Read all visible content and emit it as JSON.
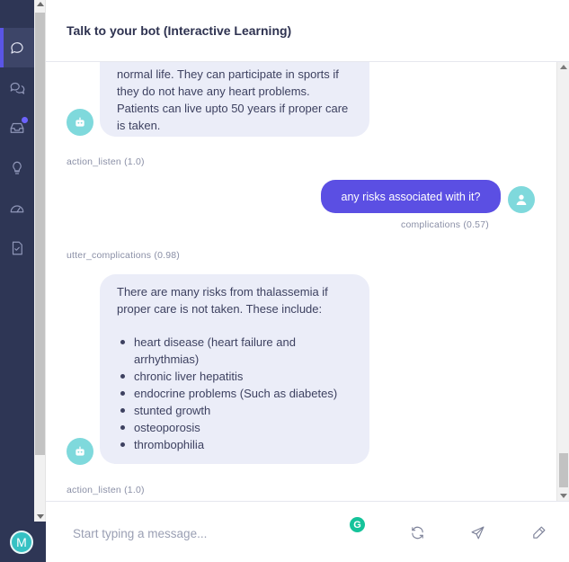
{
  "header": {
    "title": "Talk to your bot (Interactive Learning)"
  },
  "rail": {
    "items": [
      {
        "icon": "chat-bubble-icon",
        "active": true
      },
      {
        "icon": "conversations-icon",
        "active": false
      },
      {
        "icon": "inbox-icon",
        "active": false,
        "notification": true
      },
      {
        "icon": "lightbulb-icon",
        "active": false
      },
      {
        "icon": "gauge-icon",
        "active": false
      },
      {
        "icon": "document-check-icon",
        "active": false
      }
    ],
    "user_initial": "M"
  },
  "chat": {
    "messages": [
      {
        "role": "bot",
        "lines": [
          "normal life. They can participate in sports if",
          "they do not have any heart problems.",
          "Patients can live upto 50 years if proper care",
          "is taken."
        ]
      },
      {
        "role": "action",
        "text": "action_listen (1.0)"
      },
      {
        "role": "user",
        "text": "any risks associated with it?",
        "intent": "complications (0.57)"
      },
      {
        "role": "action",
        "text": "utter_complications (0.98)"
      },
      {
        "role": "bot",
        "intro": [
          "There are many risks from thalassemia if",
          "proper care is not taken. These include:"
        ],
        "bullets": [
          "heart disease (heart failure and",
          "arrhythmias)",
          "chronic liver hepatitis",
          "endocrine problems (Such as diabetes)",
          "stunted growth",
          "osteoporosis",
          "thrombophilia"
        ]
      },
      {
        "role": "action",
        "text": "action_listen (1.0)"
      }
    ]
  },
  "composer": {
    "placeholder": "Start typing a message...",
    "value": "",
    "grammarly_badge": "G",
    "buttons": [
      "restart-icon",
      "send-icon",
      "pen-icon"
    ]
  },
  "colors": {
    "rail_bg": "#2e3655",
    "accent": "#5b4fe3",
    "bot_bubble": "#ebedf8",
    "avatar": "#7fd9dc",
    "grammarly": "#15c39a"
  }
}
